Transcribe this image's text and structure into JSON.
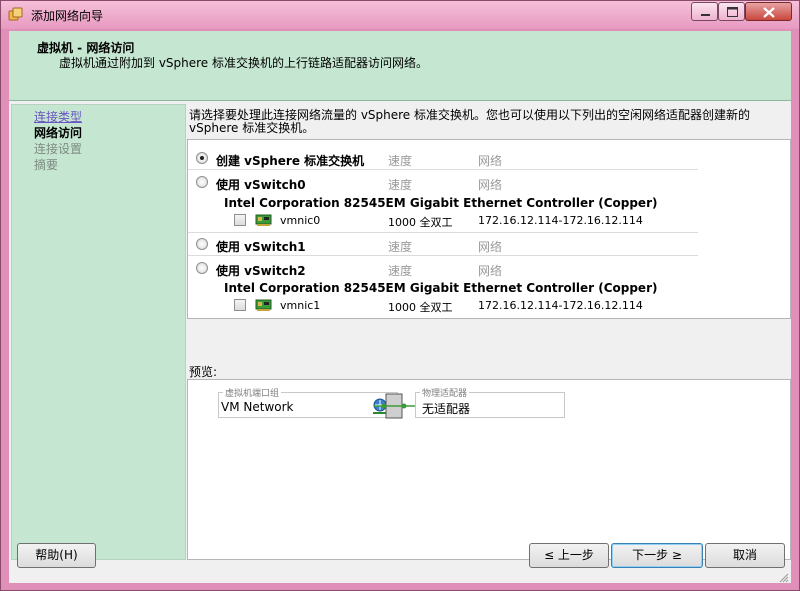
{
  "window": {
    "title": "添加网络向导"
  },
  "header": {
    "title": "虚拟机 - 网络访问",
    "description": "虚拟机通过附加到 vSphere 标准交换机的上行链路适配器访问网络。"
  },
  "nav": {
    "items": [
      {
        "label": "连接类型",
        "state": "link"
      },
      {
        "label": "网络访问",
        "state": "current"
      },
      {
        "label": "连接设置",
        "state": "disabled"
      },
      {
        "label": "摘要",
        "state": "disabled"
      }
    ]
  },
  "main": {
    "instruction": "请选择要处理此连接网络流量的 vSphere 标准交换机。您也可以使用以下列出的空闲网络适配器创建新的 vSphere 标准交换机。",
    "col_speed": "速度",
    "col_network": "网络",
    "options": [
      {
        "label": "创建 vSphere 标准交换机",
        "selected": true
      },
      {
        "label": "使用 vSwitch0",
        "selected": false,
        "adapter": "Intel Corporation 82545EM Gigabit Ethernet Controller (Copper)",
        "nic": {
          "name": "vmnic0",
          "speed": "1000 全双工",
          "network": "172.16.12.114-172.16.12.114",
          "checked": false
        }
      },
      {
        "label": "使用 vSwitch1",
        "selected": false
      },
      {
        "label": "使用 vSwitch2",
        "selected": false,
        "adapter": "Intel Corporation 82545EM Gigabit Ethernet Controller (Copper)",
        "nic": {
          "name": "vmnic1",
          "speed": "1000 全双工",
          "network": "172.16.12.114-172.16.12.114",
          "checked": false
        }
      }
    ]
  },
  "preview": {
    "label": "预览:",
    "port_group_legend": "虚拟机端口组",
    "port_group_name": "VM Network",
    "physical_adapter_legend": "物理适配器",
    "physical_adapter_value": "无适配器"
  },
  "buttons": {
    "help": "帮助(H)",
    "back": "≤ 上一步",
    "next": "下一步 ≥",
    "cancel": "取消"
  },
  "colors": {
    "titlebar": "#e79ac0",
    "accent_green": "#c5e7d1",
    "link": "#6a55c0"
  }
}
